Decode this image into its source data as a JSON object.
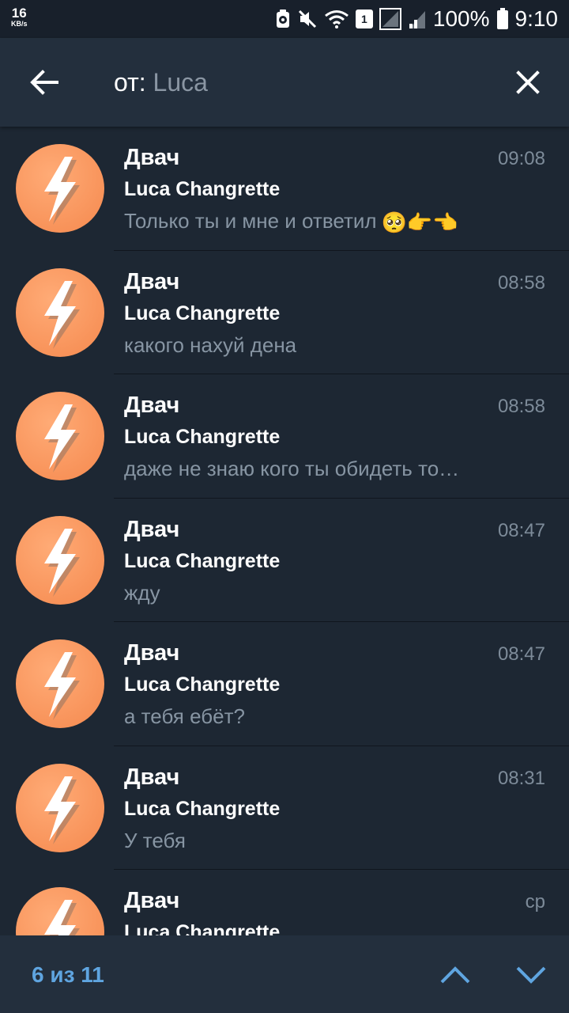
{
  "status_bar": {
    "net_speed_value": "16",
    "net_speed_unit": "KB/s",
    "sim_slot": "1",
    "battery": "100%",
    "time": "9:10"
  },
  "app_bar": {
    "search_prefix": "от:",
    "search_query": "Luca"
  },
  "results": [
    {
      "title": "Двач",
      "time": "09:08",
      "sender": "Luca Changrette",
      "text": "Только ты и мне и ответил",
      "emoji": "🥺👉👈"
    },
    {
      "title": "Двач",
      "time": "08:58",
      "sender": "Luca Changrette",
      "text": "какого нахуй дена"
    },
    {
      "title": "Двач",
      "time": "08:58",
      "sender": "Luca Changrette",
      "text": "даже не знаю кого ты обидеть то…"
    },
    {
      "title": "Двач",
      "time": "08:47",
      "sender": "Luca Changrette",
      "text": "жду"
    },
    {
      "title": "Двач",
      "time": "08:47",
      "sender": "Luca Changrette",
      "text": "а тебя ебёт?"
    },
    {
      "title": "Двач",
      "time": "08:31",
      "sender": "Luca Changrette",
      "text": "У тебя"
    },
    {
      "title": "Двач",
      "time": "ср",
      "sender": "Luca Changrette",
      "text": ""
    }
  ],
  "bottom_bar": {
    "counter": "6 из 11"
  },
  "colors": {
    "background": "#1d2733",
    "app_bar": "#232f3d",
    "avatar": "#f8935a",
    "accent": "#5fa5e0",
    "secondary_text": "#8795a3"
  },
  "icons": {
    "back": "arrow-left-icon",
    "close": "close-icon",
    "avatar": "lightning-bolt-icon",
    "nav_up": "chevron-up-icon",
    "nav_down": "chevron-down-icon"
  }
}
